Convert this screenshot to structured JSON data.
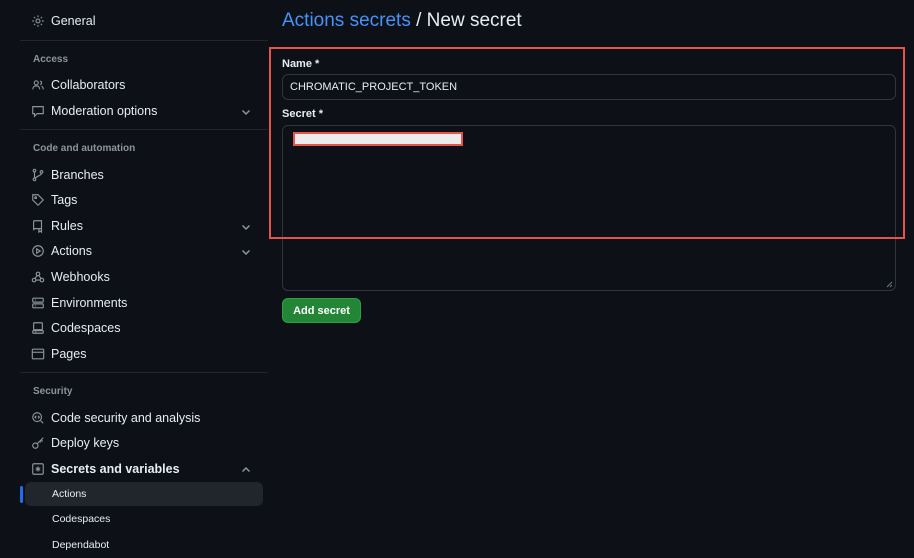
{
  "sidebar": {
    "general": {
      "label": "General",
      "icon": "gear-icon"
    },
    "sections": {
      "access": "Access",
      "code_automation": "Code and automation",
      "security": "Security"
    },
    "items": {
      "collaborators": {
        "label": "Collaborators",
        "icon": "people-icon"
      },
      "moderation": {
        "label": "Moderation options",
        "icon": "comment-icon"
      },
      "branches": {
        "label": "Branches",
        "icon": "git-branch-icon"
      },
      "tags": {
        "label": "Tags",
        "icon": "tag-icon"
      },
      "rules": {
        "label": "Rules",
        "icon": "repo-push-icon"
      },
      "actions": {
        "label": "Actions",
        "icon": "play-icon"
      },
      "webhooks": {
        "label": "Webhooks",
        "icon": "webhook-icon"
      },
      "environments": {
        "label": "Environments",
        "icon": "server-icon"
      },
      "codespaces": {
        "label": "Codespaces",
        "icon": "codespaces-icon"
      },
      "pages": {
        "label": "Pages",
        "icon": "browser-icon"
      },
      "code_security": {
        "label": "Code security and analysis",
        "icon": "codescan-icon"
      },
      "deploy_keys": {
        "label": "Deploy keys",
        "icon": "key-icon"
      },
      "secrets": {
        "label": "Secrets and variables",
        "icon": "asterisk-icon"
      }
    },
    "subitems": {
      "actions": "Actions",
      "codespaces": "Codespaces",
      "dependabot": "Dependabot"
    }
  },
  "main": {
    "breadcrumb_link": "Actions secrets",
    "breadcrumb_sep": "/",
    "title": "New secret",
    "name_label": "Name *",
    "name_value": "CHROMATIC_PROJECT_TOKEN",
    "secret_label": "Secret *",
    "submit_label": "Add secret"
  },
  "colors": {
    "accent_blue": "#4493f8",
    "button_green": "#238636",
    "highlight_red": "#e5534b"
  }
}
